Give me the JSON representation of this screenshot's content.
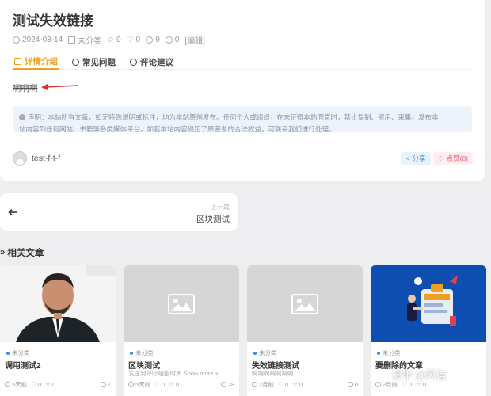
{
  "post": {
    "title": "测试失效链接",
    "date": "2024-03-14",
    "category": "未分类",
    "stars": "0",
    "likes": "0",
    "views": "9",
    "comments": "0",
    "edit": "[编辑]",
    "tabs": [
      {
        "label": "详情介绍",
        "icon": "document-icon"
      },
      {
        "label": "常见问题",
        "icon": "question-icon"
      },
      {
        "label": "评论建议",
        "icon": "comment-icon"
      }
    ],
    "content": "啊啊啊",
    "notice_line1": "声明：本站所有文章，如无特殊说明或标注，均为本站原创发布。任何个人或组织，在未征得本站同意时，禁止复制、盗用、采集、发布本",
    "notice_line2": "站内容到任何网站、书籍等各类媒体平台。如若本站内容侵犯了原著者的合法权益，可联系我们进行处理。",
    "author": "test-f-t-f",
    "share_label": "分享",
    "like_label": "点赞(0)"
  },
  "prev": {
    "label": "上一篇",
    "title": "区块测试"
  },
  "related": {
    "title": "相关文章",
    "items": [
      {
        "category": "未分类",
        "title": "调用测试2",
        "excerpt": "",
        "time": "5天前",
        "likes": "0",
        "stars": "0",
        "views": "7",
        "thumb": "portrait"
      },
      {
        "category": "未分类",
        "title": "区块测试",
        "excerpt": "发送到呼吁哦按时大 Show more +...",
        "time": "5天前",
        "likes": "0",
        "stars": "0",
        "views": "28",
        "thumb": "placeholder"
      },
      {
        "category": "未分类",
        "title": "失效链接测试",
        "excerpt": "啊啊啊啊啊啊啊",
        "time": "2月前",
        "likes": "0",
        "stars": "0",
        "views": "0",
        "thumb": "placeholder"
      },
      {
        "category": "未分类",
        "title": "要删除的文章",
        "excerpt": "",
        "time": "2月前",
        "likes": "0",
        "stars": "0",
        "views": "",
        "thumb": "illustration"
      }
    ]
  },
  "watermark": "知乎 @风信",
  "colors": {
    "accent": "#f0a020",
    "share": "#3a8ee6",
    "like": "#e06070",
    "arrow": "#e03030"
  }
}
